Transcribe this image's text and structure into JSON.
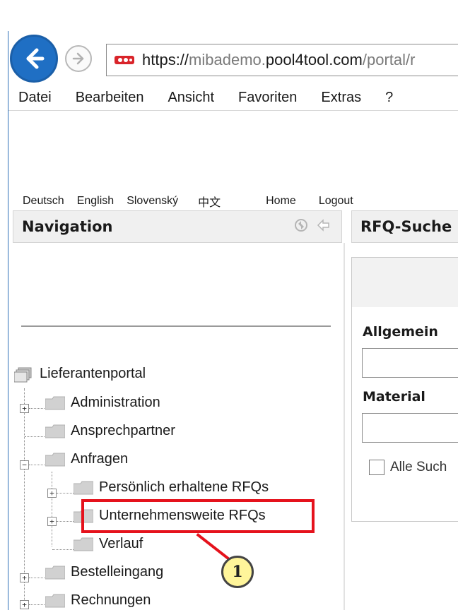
{
  "browser": {
    "url_scheme": "https://",
    "url_subdomain": "mibademo.",
    "url_domain": "pool4tool.com",
    "url_path": "/portal/r",
    "menu": [
      "Datei",
      "Bearbeiten",
      "Ansicht",
      "Favoriten",
      "Extras",
      "?"
    ]
  },
  "languages": [
    "Deutsch",
    "English",
    "Slovenský",
    "中文"
  ],
  "top_links": {
    "home": "Home",
    "logout": "Logout"
  },
  "navigation": {
    "title": "Navigation",
    "tree": {
      "root": "Lieferantenportal",
      "items": [
        {
          "label": "Administration"
        },
        {
          "label": "Ansprechpartner"
        },
        {
          "label": "Anfragen",
          "children": [
            {
              "label": "Persönlich erhaltene RFQs"
            },
            {
              "label": "Unternehmensweite RFQs"
            },
            {
              "label": "Verlauf"
            }
          ]
        },
        {
          "label": "Bestelleingang"
        },
        {
          "label": "Rechnungen"
        }
      ]
    }
  },
  "rfq_panel": {
    "title": "RFQ-Suche",
    "general_label": "Allgemein",
    "material_label": "Material",
    "all_search_label": "Alle Such"
  },
  "annotation": {
    "number": "1"
  },
  "colors": {
    "highlight": "#e5121c",
    "callout_fill": "#fff59a",
    "back_button": "#1f6fc4"
  }
}
